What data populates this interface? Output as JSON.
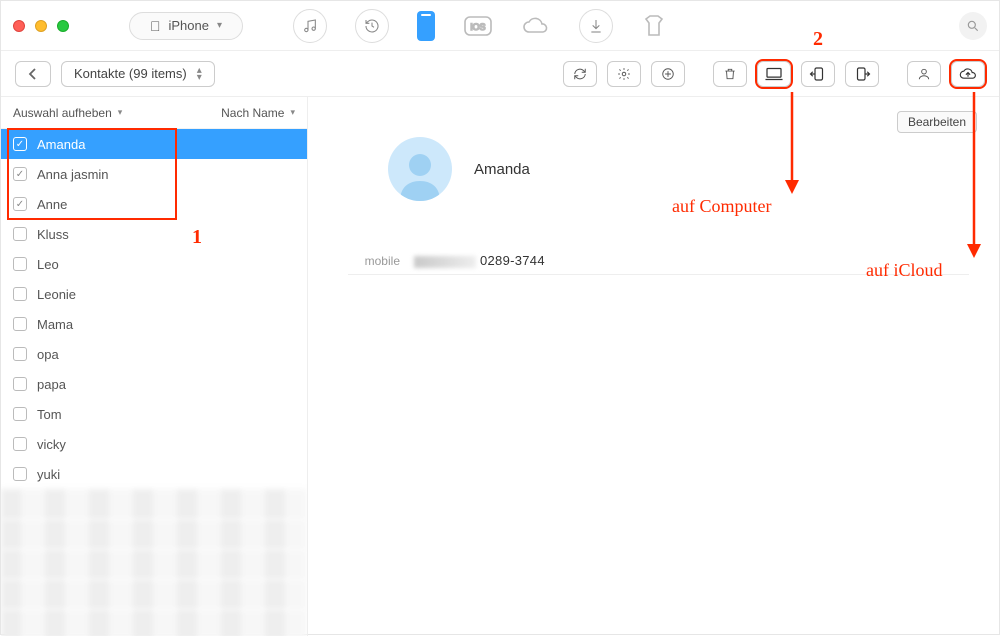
{
  "device_label": "iPhone",
  "breadcrumb": "Kontakte (99 items)",
  "sidebar": {
    "deselect_label": "Auswahl aufheben",
    "sort_label": "Nach Name"
  },
  "contacts": [
    {
      "name": "Amanda",
      "checked": true,
      "selected": true
    },
    {
      "name": "Anna jasmin",
      "checked": true,
      "selected": false
    },
    {
      "name": "Anne",
      "checked": true,
      "selected": false
    },
    {
      "name": "Kluss",
      "checked": false,
      "selected": false
    },
    {
      "name": "Leo",
      "checked": false,
      "selected": false
    },
    {
      "name": "Leonie",
      "checked": false,
      "selected": false
    },
    {
      "name": "Mama",
      "checked": false,
      "selected": false
    },
    {
      "name": "opa",
      "checked": false,
      "selected": false
    },
    {
      "name": "papa",
      "checked": false,
      "selected": false
    },
    {
      "name": "Tom",
      "checked": false,
      "selected": false
    },
    {
      "name": "vicky",
      "checked": false,
      "selected": false
    },
    {
      "name": "yuki",
      "checked": false,
      "selected": false
    }
  ],
  "detail": {
    "edit_label": "Bearbeiten",
    "name": "Amanda",
    "phone_label": "mobile",
    "phone_value": "0289-3744"
  },
  "annotations": {
    "step1": "1",
    "step2": "2",
    "to_computer": "auf Computer",
    "to_icloud": "auf iCloud"
  }
}
